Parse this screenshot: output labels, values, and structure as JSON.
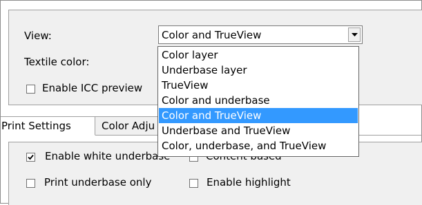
{
  "view": {
    "label": "View:",
    "selected": "Color and TrueView",
    "options": [
      "Color layer",
      "Underbase layer",
      "TrueView",
      "Color and underbase",
      "Color and TrueView",
      "Underbase and TrueView",
      "Color, underbase, and TrueView"
    ],
    "highlighted_index": 4
  },
  "textile_color": {
    "label": "Textile color:"
  },
  "icc_preview": {
    "label": "Enable ICC preview",
    "checked": false
  },
  "tabs": [
    {
      "label": "Print Settings",
      "active": true
    },
    {
      "label": "Color Adju",
      "active": false
    }
  ],
  "print_settings": {
    "enable_white_underbase": {
      "label": "Enable white underbase",
      "checked": true
    },
    "content_based": {
      "label": "Content based",
      "checked": false
    },
    "print_underbase_only": {
      "label": "Print underbase only",
      "checked": false
    },
    "enable_highlight": {
      "label": "Enable highlight",
      "checked": false
    }
  },
  "colors": {
    "highlight": "#3399ff",
    "panel": "#f0f0f0",
    "border": "#9e9e9e"
  }
}
